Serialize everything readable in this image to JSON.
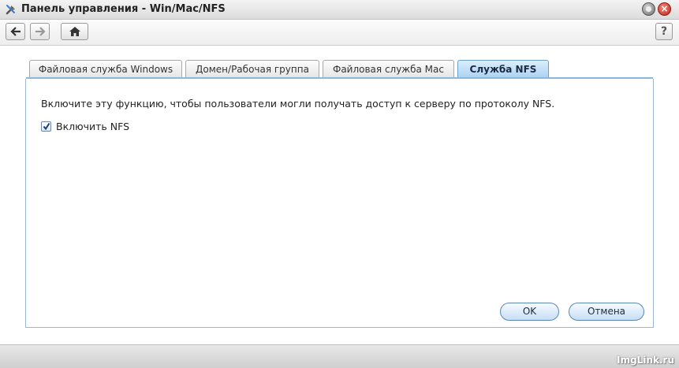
{
  "window": {
    "title": "Панель управления - Win/Mac/NFS"
  },
  "toolbar": {
    "back": "back-arrow",
    "forward": "forward-arrow",
    "home": "home",
    "help": "?"
  },
  "tabs": [
    {
      "label": "Файловая служба Windows",
      "active": false
    },
    {
      "label": "Домен/Рабочая группа",
      "active": false
    },
    {
      "label": "Файловая служба Mac",
      "active": false
    },
    {
      "label": "Служба NFS",
      "active": true
    }
  ],
  "nfs": {
    "description": "Включите эту функцию, чтобы пользователи могли получать доступ к серверу по протоколу NFS.",
    "enable_label": "Включить NFS",
    "enabled": true
  },
  "buttons": {
    "ok": "OK",
    "cancel": "Отмена"
  },
  "watermark": "ImgLink.ru",
  "colors": {
    "active_tab": "#a9d2f4",
    "panel_border": "#9bb7d2",
    "close_button": "#c0261a"
  }
}
